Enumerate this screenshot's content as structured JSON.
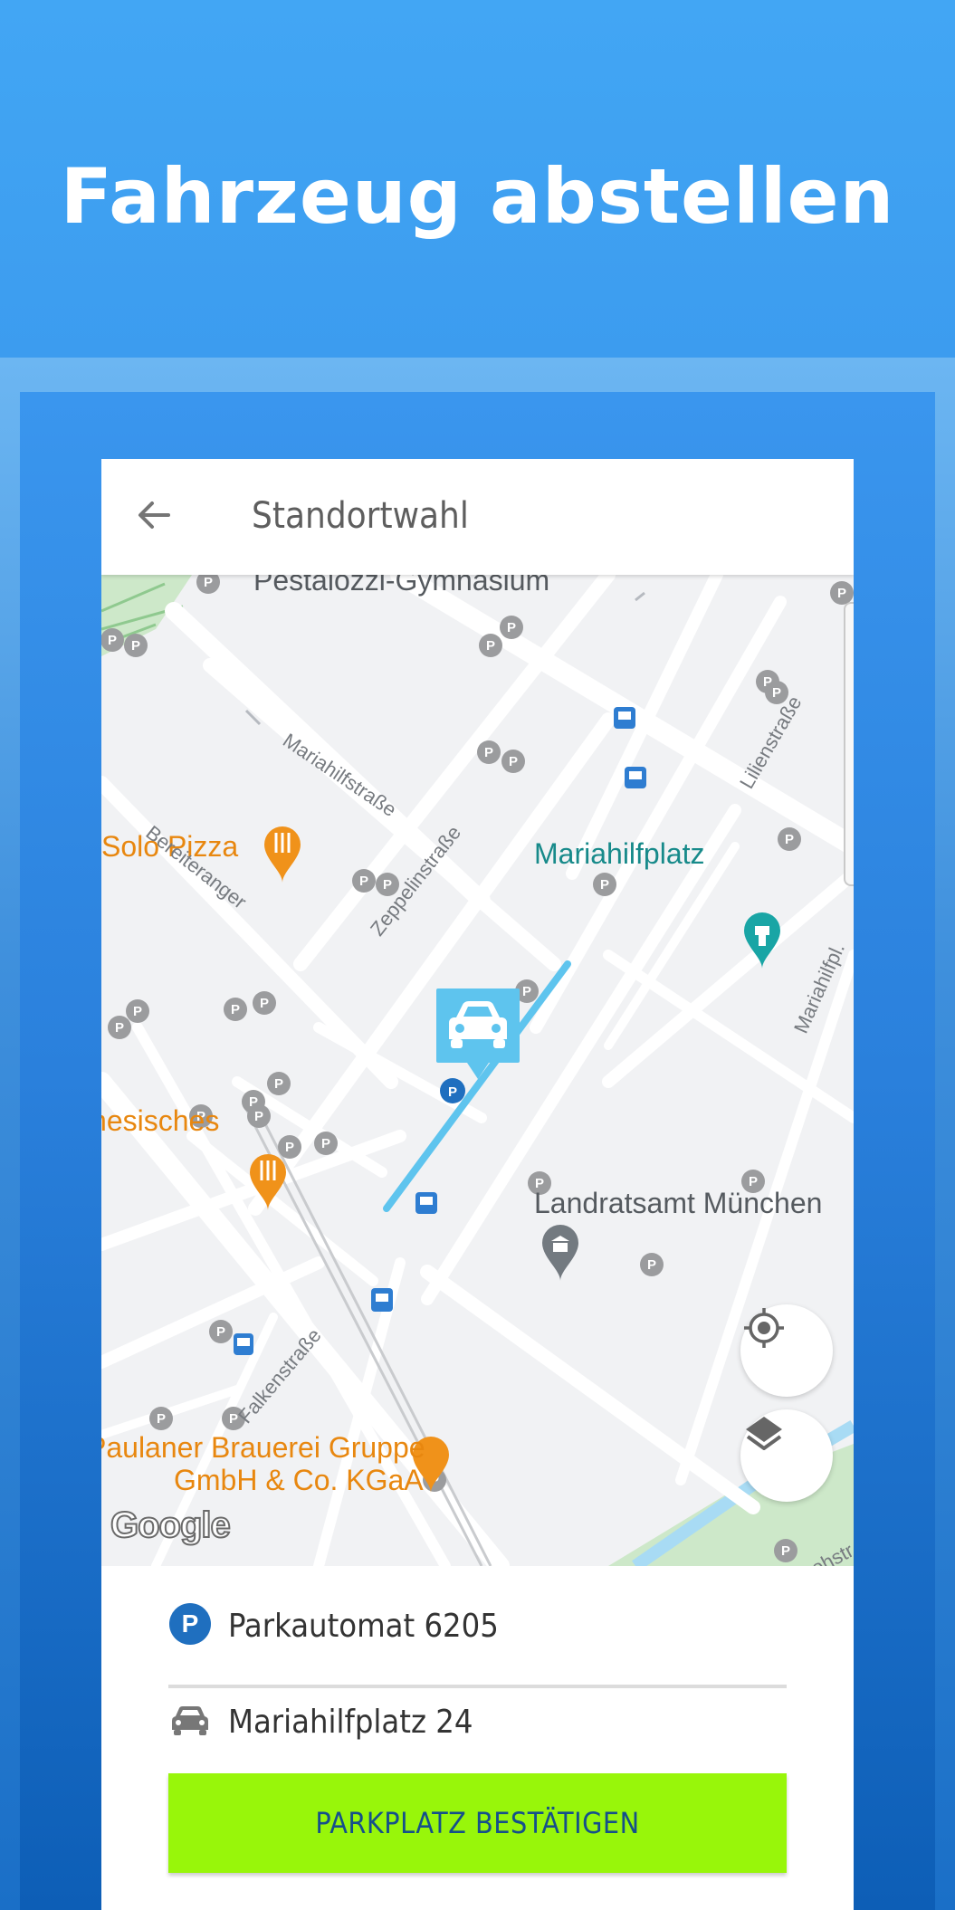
{
  "header": {
    "headline": "Fahrzeug abstellen"
  },
  "appbar": {
    "title": "Standortwahl",
    "back_icon": "arrow-left-icon"
  },
  "map": {
    "labels": {
      "school": "Pestalozzi-Gymnasium",
      "solo_pizza": "Solo Pizza",
      "mariahilfplatz": "Mariahilfplatz",
      "chinese": "Chinesisches",
      "landratsamt": "Landratsamt München",
      "paulaner_line1": "Paulaner Brauerei Gruppe",
      "paulaner_line2": "GmbH & Co. KGaA",
      "street_mariahilfstrasse": "Mariahilfstraße",
      "street_bereiteranger": "Bereiteranger",
      "street_zeppelinstrasse": "Zeppelinstraße",
      "street_lilienstrasse": "Lilienstraße",
      "street_mariahilfpl": "Mariahilfpl.",
      "street_falkenstrasse": "Falkenstraße",
      "street_ohstr": "ohstr."
    },
    "attribution": "Google",
    "parking_letter": "P"
  },
  "controls": {
    "locate_icon": "my-location-icon",
    "layers_icon": "layers-icon"
  },
  "panel": {
    "parking_icon": "parking-icon",
    "parking_machine": "Parkautomat 6205",
    "car_icon": "car-icon",
    "address": "Mariahilfplatz 24",
    "confirm_label": "PARKPLATZ BESTÄTIGEN"
  },
  "colors": {
    "accent_blue": "#3c9cef",
    "confirm_green": "#98f60a",
    "marker_cyan": "#5ec4ee",
    "poi_orange": "#e8870f",
    "poi_teal": "#19a5a5"
  }
}
